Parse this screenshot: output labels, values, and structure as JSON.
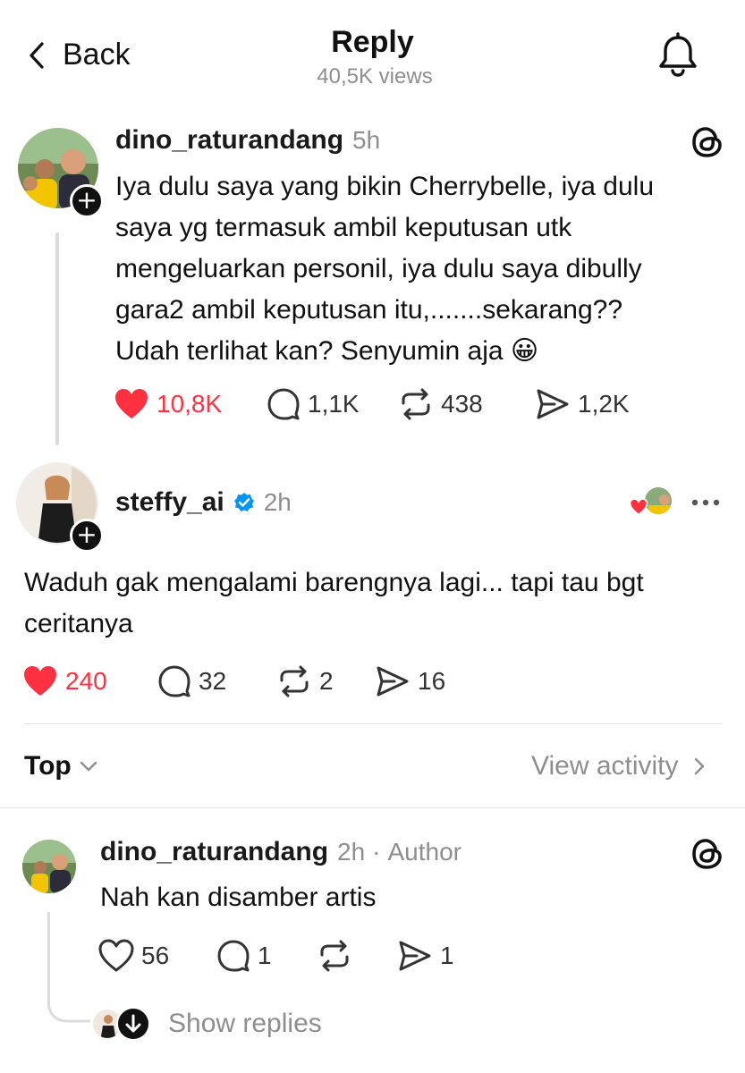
{
  "header": {
    "back_label": "Back",
    "title": "Reply",
    "views": "40,5K views"
  },
  "post": {
    "username": "dino_raturandang",
    "time": "5h",
    "lines": [
      "Iya dulu saya yang bikin Cherrybelle, iya dulu",
      "saya yg termasuk ambil keputusan utk",
      "mengeluarkan personil, iya dulu saya dibully",
      "gara2 ambil keputusan itu,.......sekarang??",
      "Udah terlihat kan? Senyumin aja 😀"
    ],
    "likes": "10,8K",
    "comments": "1,1K",
    "reposts": "438",
    "shares": "1,2K"
  },
  "reply": {
    "username": "steffy_ai",
    "verified": true,
    "time": "2h",
    "lines": [
      "Waduh gak mengalami barengnya lagi... tapi tau bgt",
      "ceritanya"
    ],
    "likes": "240",
    "comments": "32",
    "reposts": "2",
    "shares": "16"
  },
  "sort": {
    "label": "Top",
    "view_activity": "View activity"
  },
  "sub_reply": {
    "username": "dino_raturandang",
    "time": "2h",
    "separator": "·",
    "badge": "Author",
    "text": "Nah kan disamber artis",
    "likes": "56",
    "comments": "1",
    "reposts": "",
    "shares": "1",
    "show_replies": "Show replies"
  },
  "colors": {
    "like_red": "#ff3040",
    "verified_blue": "#0095f6",
    "muted": "#8e8e8e"
  },
  "icons": [
    "chevron-left-icon",
    "bell-icon",
    "threads-icon",
    "heart-icon",
    "comment-icon",
    "repost-icon",
    "share-icon",
    "verified-icon",
    "more-icon",
    "chevron-down-icon",
    "chevron-right-icon",
    "arrow-down-icon"
  ]
}
